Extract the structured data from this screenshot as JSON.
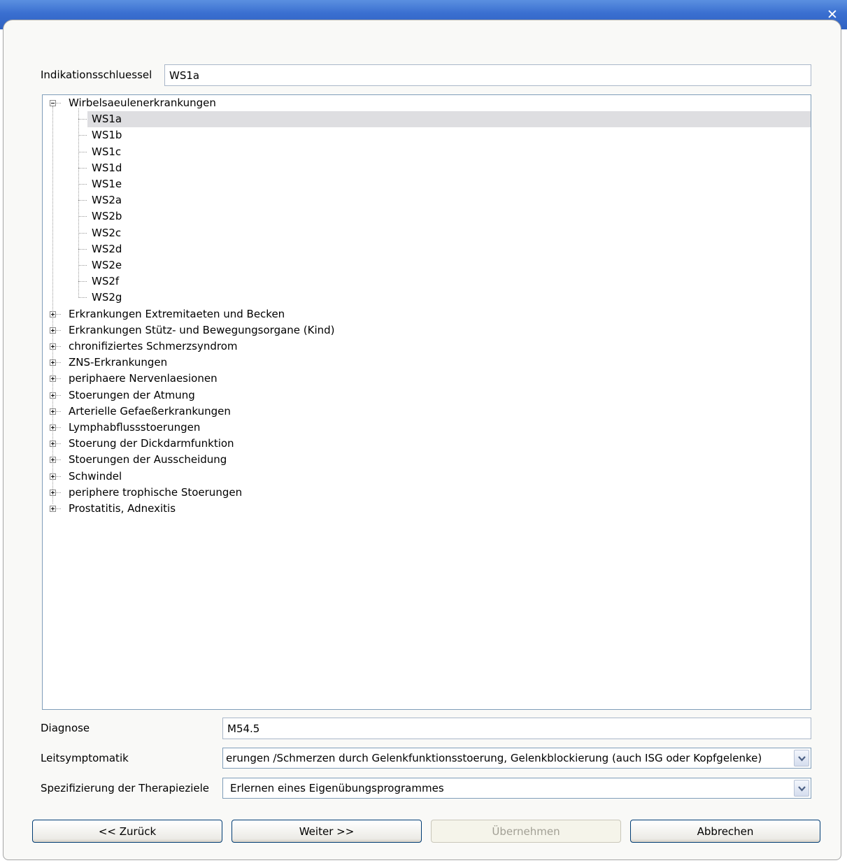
{
  "window": {
    "close_glyph": "✕"
  },
  "form": {
    "indikation_label": "Indikationsschluessel",
    "indikation_value": "WS1a",
    "diagnose_label": "Diagnose",
    "diagnose_value": "M54.5",
    "leitsymptomatik_label": "Leitsymptomatik",
    "leitsymptomatik_value": "erungen /Schmerzen durch Gelenkfunktionsstoerung, Gelenkblockierung (auch ISG oder Kopfgelenke)",
    "spezifizierung_label": "Spezifizierung der Therapieziele",
    "spezifizierung_value": "Erlernen eines Eigenübungsprogrammes"
  },
  "tree": {
    "expanded_group": {
      "label": "Wirbelsaeulenerkrankungen",
      "children": [
        "WS1a",
        "WS1b",
        "WS1c",
        "WS1d",
        "WS1e",
        "WS2a",
        "WS2b",
        "WS2c",
        "WS2d",
        "WS2e",
        "WS2f",
        "WS2g"
      ],
      "selected": "WS1a"
    },
    "collapsed_groups": [
      "Erkrankungen Extremitaeten und Becken",
      "Erkrankungen Stütz- und Bewegungsorgane (Kind)",
      "chronifiziertes Schmerzsyndrom",
      "ZNS-Erkrankungen",
      "periphaere Nervenlaesionen",
      "Stoerungen der Atmung",
      "Arterielle Gefaeßerkrankungen",
      "Lymphabflussstoerungen",
      "Stoerung der Dickdarmfunktion",
      "Stoerungen der Ausscheidung",
      "Schwindel",
      "periphere trophische Stoerungen",
      "Prostatitis,  Adnexitis"
    ]
  },
  "buttons": {
    "back": "<< Zurück",
    "next": "Weiter >>",
    "apply": "Übernehmen",
    "cancel": "Abbrechen"
  },
  "icons": {
    "close": "close-icon",
    "expand": "plus-box-icon",
    "collapse": "minus-box-icon",
    "dropdown": "chevron-down-icon"
  }
}
